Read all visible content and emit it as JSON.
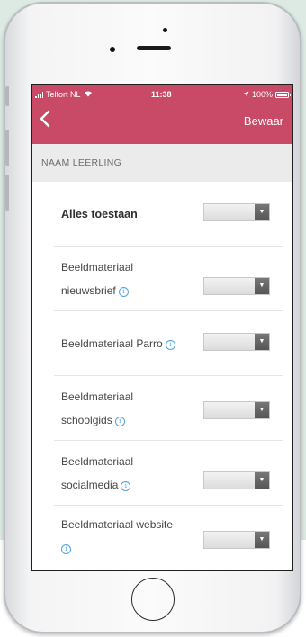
{
  "status_bar": {
    "carrier": "Telfort NL",
    "time": "11:38",
    "battery": "100%"
  },
  "header": {
    "back_icon": "chevron-left-icon",
    "save_label": "Bewaar",
    "accent_color": "#c94a66"
  },
  "section": {
    "title": "NAAM LEERLING"
  },
  "permissions": [
    {
      "line1": "Alles toestaan",
      "line2": ""
    },
    {
      "line1": "Beeldmateriaal",
      "line2": "nieuwsbrief"
    },
    {
      "line1": "Beeldmateriaal Parro",
      "line2": ""
    },
    {
      "line1": "Beeldmateriaal",
      "line2": "schoolgids"
    },
    {
      "line1": "Beeldmateriaal",
      "line2": "socialmedia"
    },
    {
      "line1": "Beeldmateriaal website",
      "line2": ""
    }
  ]
}
